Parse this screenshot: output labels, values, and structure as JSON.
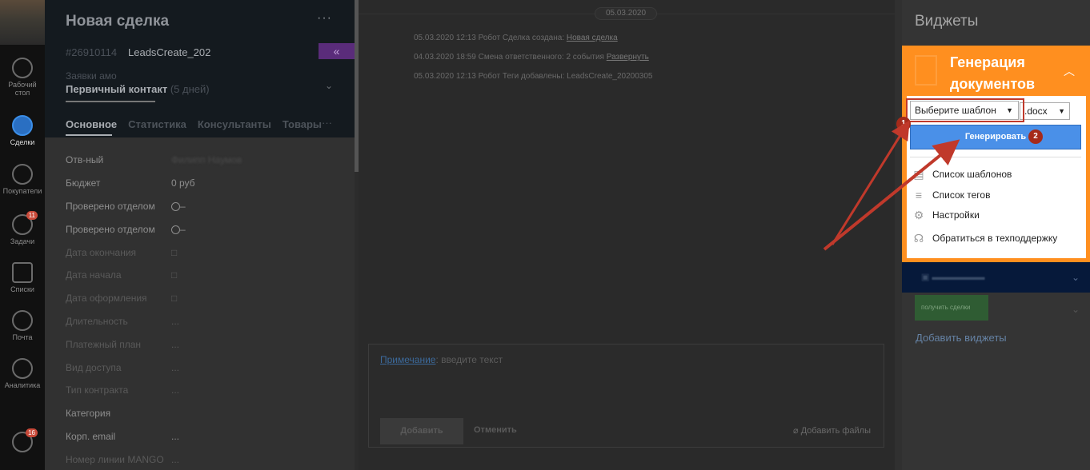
{
  "nav": {
    "items": [
      {
        "label": "Рабочий стол"
      },
      {
        "label": "Сделки"
      },
      {
        "label": "Покупатели"
      },
      {
        "label": "Задачи",
        "badge": "11"
      },
      {
        "label": "Списки"
      },
      {
        "label": "Почта"
      },
      {
        "label": "Аналитика"
      },
      {
        "label": "",
        "badge": "16"
      }
    ]
  },
  "card": {
    "title": "Новая сделка",
    "id": "#26910114",
    "lead_name": "LeadsCreate_202",
    "pipeline": "Заявки амо",
    "stage": "Первичный контакт",
    "stage_days": "(5 дней)",
    "tabs": [
      "Основное",
      "Статистика",
      "Консультанты",
      "Товары"
    ],
    "fields": [
      {
        "label": "Отв-ный",
        "value": "Филипп Наумов"
      },
      {
        "label": "Бюджет",
        "value": "0 руб"
      },
      {
        "label": "Проверено отделом",
        "value": ""
      },
      {
        "label": "Проверено отделом",
        "value": ""
      },
      {
        "label": "Дата окончания",
        "value": "□"
      },
      {
        "label": "Дата начала",
        "value": "□"
      },
      {
        "label": "Дата оформления",
        "value": "□"
      },
      {
        "label": "Длительность",
        "value": "..."
      },
      {
        "label": "Платежный план",
        "value": "..."
      },
      {
        "label": "Вид доступа",
        "value": "..."
      },
      {
        "label": "Тип контракта",
        "value": "..."
      },
      {
        "label": "Категория",
        "value": ""
      },
      {
        "label": "Корп. email",
        "value": "..."
      },
      {
        "label": "Номер линии MANGO",
        "value": "..."
      }
    ]
  },
  "feed": {
    "date": "05.03.2020",
    "events": [
      {
        "text": "05.03.2020 12:13 Робот  Сделка создана: ",
        "link": "Новая сделка"
      },
      {
        "text": "04.03.2020 18:59 Смена ответственного: 2 события ",
        "link": "Развернуть"
      },
      {
        "text": "05.03.2020 12:13 Робот  Теги добавлены: LeadsCreate_20200305",
        "link": ""
      }
    ],
    "note_label": "Примечание",
    "note_placeholder": ": введите текст",
    "add_button": "Добавить",
    "cancel_button": "Отменить",
    "attach": "Добавить файлы"
  },
  "widgets": {
    "title": "Виджеты",
    "gen": {
      "title_line1": "Генерация",
      "title_line2": "документов",
      "template_select": "Выберите шаблон",
      "format_select": ".docx",
      "generate_button": "Генерировать",
      "menu": [
        {
          "label": "Список шаблонов",
          "icon": "doc-icon"
        },
        {
          "label": "Список тегов",
          "icon": "list-icon"
        },
        {
          "label": "Настройки",
          "icon": "gear-icon"
        },
        {
          "label": "Обратиться в техподдержку",
          "icon": "headset-icon"
        }
      ]
    },
    "green_button": "получить сделки",
    "add_widgets": "Добавить виджеты"
  },
  "annotations": {
    "step1": "1",
    "step2": "2"
  },
  "colors": {
    "orange": "#ff8f1f",
    "blue_button": "#4a90e8",
    "marker_red": "#a52a1a",
    "arrow_red": "#c0392b"
  }
}
